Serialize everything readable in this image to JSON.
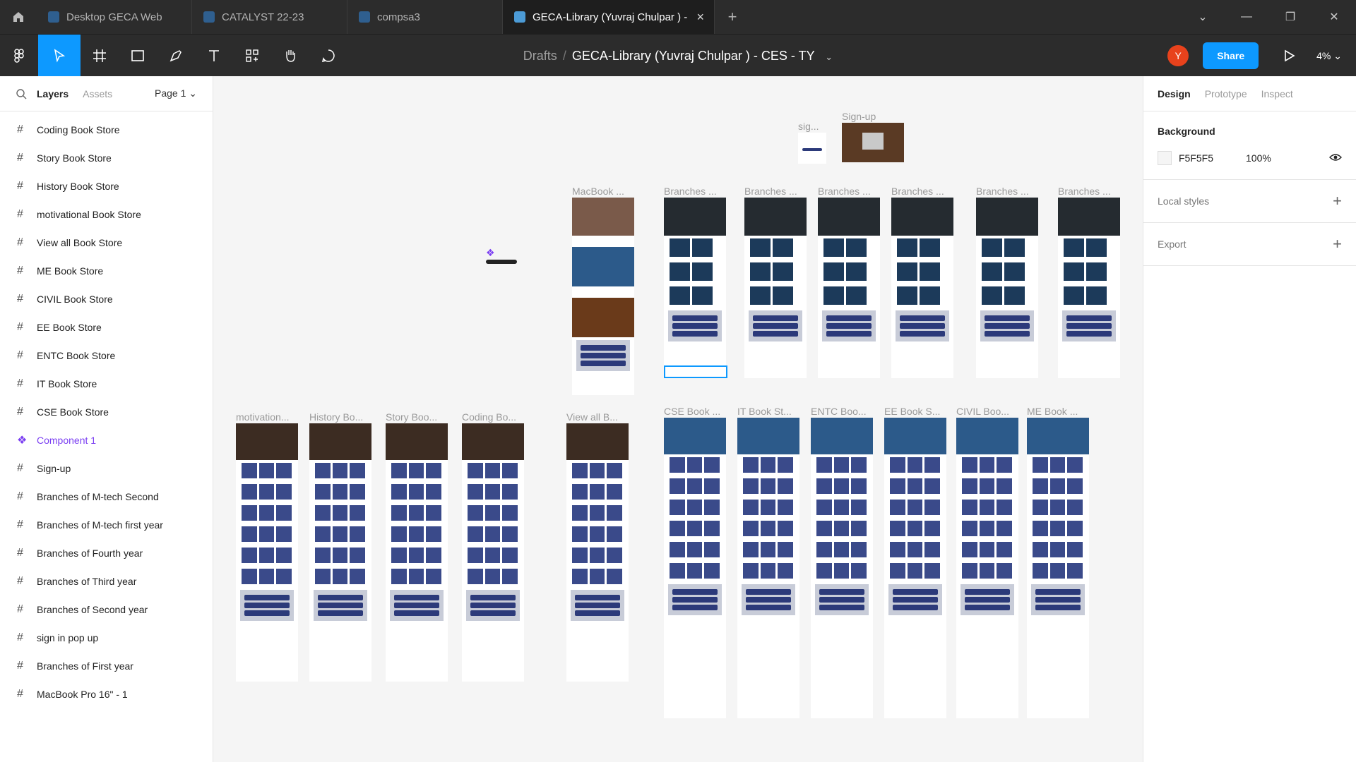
{
  "tabs": [
    {
      "label": "Desktop GECA Web",
      "active": false
    },
    {
      "label": "CATALYST 22-23",
      "active": false
    },
    {
      "label": "compsa3",
      "active": false
    },
    {
      "label": "GECA-Library (Yuvraj Chulpar ) - CES -",
      "active": true
    }
  ],
  "breadcrumb": {
    "drafts": "Drafts",
    "sep": "/",
    "file": "GECA-Library (Yuvraj Chulpar ) - CES - TY"
  },
  "user_initial": "Y",
  "share_label": "Share",
  "zoom_label": "4%",
  "left_panel": {
    "tab_layers": "Layers",
    "tab_assets": "Assets",
    "page": "Page 1",
    "layers": [
      {
        "label": "Coding Book Store",
        "type": "frame"
      },
      {
        "label": "Story Book Store",
        "type": "frame"
      },
      {
        "label": "History Book Store",
        "type": "frame"
      },
      {
        "label": "motivational Book Store",
        "type": "frame"
      },
      {
        "label": "View all Book Store",
        "type": "frame"
      },
      {
        "label": "ME Book Store",
        "type": "frame"
      },
      {
        "label": "CIVIL Book Store",
        "type": "frame"
      },
      {
        "label": "EE Book Store",
        "type": "frame"
      },
      {
        "label": "ENTC Book Store",
        "type": "frame"
      },
      {
        "label": "IT Book Store",
        "type": "frame"
      },
      {
        "label": "CSE Book Store",
        "type": "frame"
      },
      {
        "label": "Component 1",
        "type": "component"
      },
      {
        "label": "Sign-up",
        "type": "frame"
      },
      {
        "label": "Branches of M-tech Second",
        "type": "frame"
      },
      {
        "label": "Branches of M-tech first year",
        "type": "frame"
      },
      {
        "label": "Branches of Fourth year",
        "type": "frame"
      },
      {
        "label": "Branches of Third year",
        "type": "frame"
      },
      {
        "label": "Branches of Second year",
        "type": "frame"
      },
      {
        "label": "sign in pop up",
        "type": "frame"
      },
      {
        "label": "Branches of First year",
        "type": "frame"
      },
      {
        "label": "MacBook Pro 16\" - 1",
        "type": "frame"
      }
    ]
  },
  "canvas": {
    "labels": {
      "sign": "sig...",
      "signup": "Sign-up",
      "macbook": "MacBook ...",
      "branches": "Branches ...",
      "motivation": "motivation...",
      "history": "History Bo...",
      "story": "Story Boo...",
      "coding": "Coding Bo...",
      "viewall": "View all B...",
      "cse": "CSE Book ...",
      "it": "IT Book St...",
      "entc": "ENTC Boo...",
      "ee": "EE Book S...",
      "civil": "CIVIL Boo...",
      "me": "ME Book ..."
    }
  },
  "right_panel": {
    "tabs": [
      "Design",
      "Prototype",
      "Inspect"
    ],
    "background_title": "Background",
    "bg_hex": "F5F5F5",
    "bg_opacity": "100%",
    "local_styles": "Local styles",
    "export": "Export"
  },
  "colors": {
    "accent": "#0d99ff",
    "component": "#7b3ff2",
    "canvas": "#f5f5f5"
  },
  "help_label": "?"
}
